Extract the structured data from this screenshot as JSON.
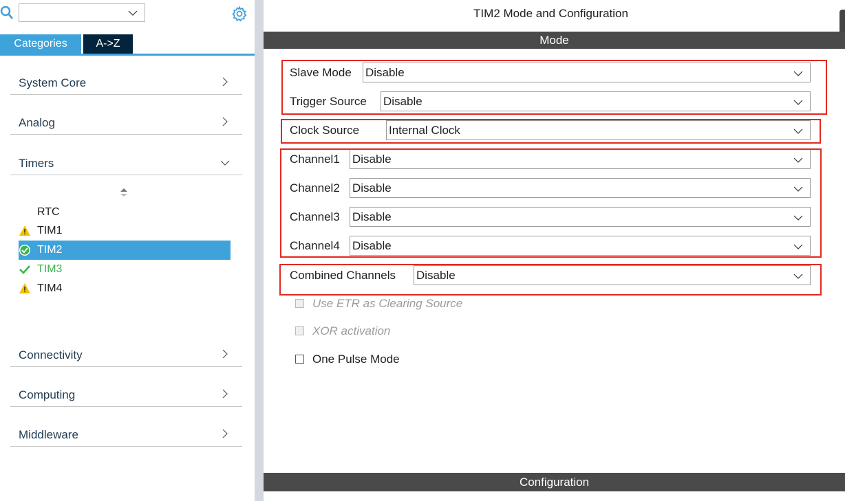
{
  "search": {
    "value": ""
  },
  "tabs": {
    "categories": "Categories",
    "az": "A->Z"
  },
  "categories": {
    "system_core": "System Core",
    "analog": "Analog",
    "timers": "Timers",
    "connectivity": "Connectivity",
    "computing": "Computing",
    "middleware": "Middleware"
  },
  "timers": [
    {
      "label": "RTC",
      "icon": "none",
      "state": "normal"
    },
    {
      "label": "TIM1",
      "icon": "warning-icon",
      "state": "normal"
    },
    {
      "label": "TIM2",
      "icon": "check-circle-icon",
      "state": "selected"
    },
    {
      "label": "TIM3",
      "icon": "check-icon",
      "state": "configured"
    },
    {
      "label": "TIM4",
      "icon": "warning-icon",
      "state": "normal"
    }
  ],
  "panel": {
    "title": "TIM2 Mode and Configuration",
    "mode_header": "Mode",
    "config_header": "Configuration"
  },
  "fields": {
    "slave_mode": {
      "label": "Slave Mode",
      "value": "Disable"
    },
    "trigger_source": {
      "label": "Trigger Source",
      "value": "Disable"
    },
    "clock_source": {
      "label": "Clock Source",
      "value": "Internal Clock"
    },
    "channel1": {
      "label": "Channel1",
      "value": "Disable"
    },
    "channel2": {
      "label": "Channel2",
      "value": "Disable"
    },
    "channel3": {
      "label": "Channel3",
      "value": "Disable"
    },
    "channel4": {
      "label": "Channel4",
      "value": "Disable"
    },
    "combined": {
      "label": "Combined Channels",
      "value": "Disable"
    }
  },
  "checkboxes": {
    "etr": {
      "label": "Use ETR as Clearing Source",
      "enabled": false,
      "checked": false
    },
    "xor": {
      "label": "XOR activation",
      "enabled": false,
      "checked": false
    },
    "one_pulse": {
      "label": "One Pulse Mode",
      "enabled": true,
      "checked": false
    }
  },
  "colors": {
    "accent": "#3ea2db",
    "dark_tab": "#02243c",
    "header_bar": "#4a4a4a",
    "highlight_box": "#e2281f",
    "warning": "#f2c200",
    "success": "#3bb54a"
  }
}
